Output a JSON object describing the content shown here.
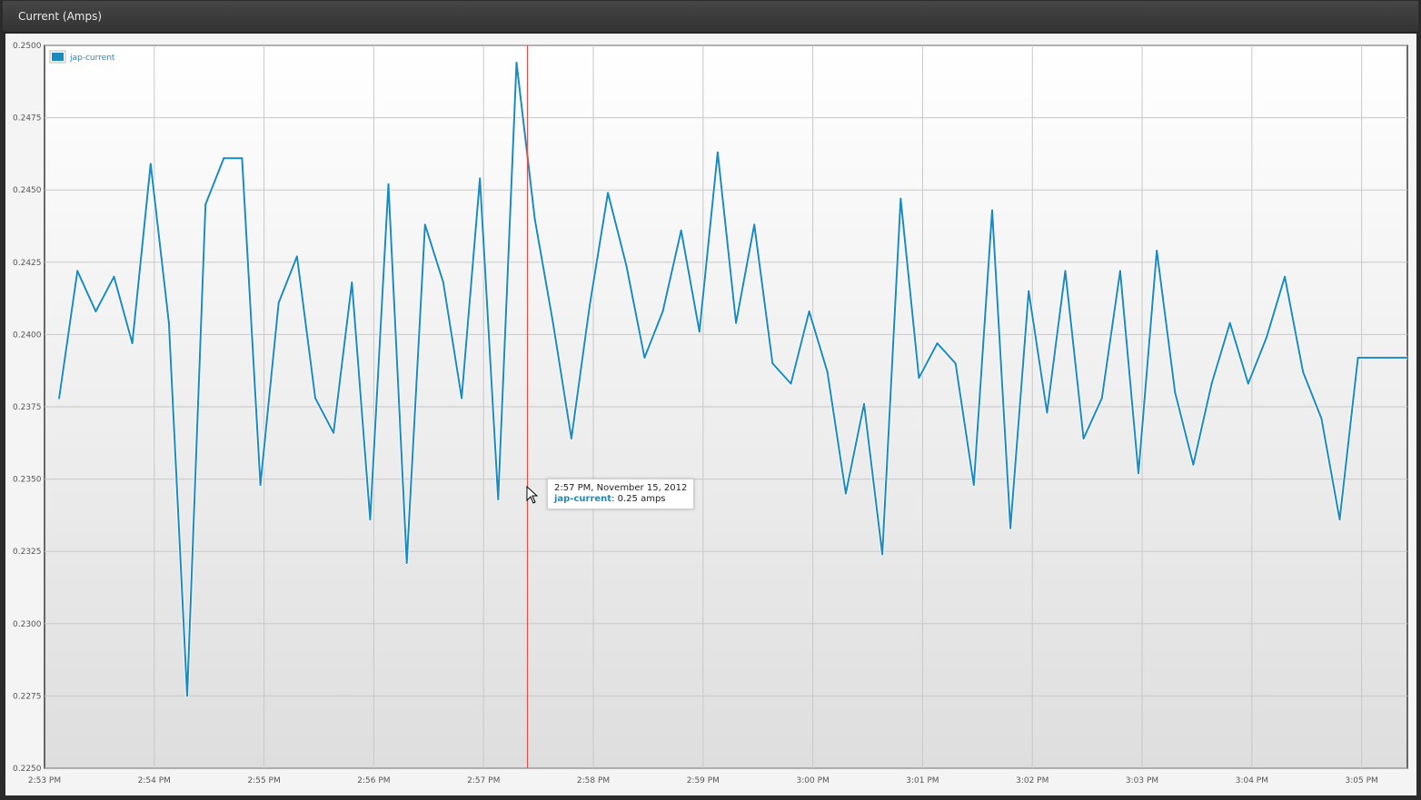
{
  "window": {
    "title": "Current (Amps)"
  },
  "tooltip": {
    "time": "2:57 PM, November 15, 2012",
    "series": "jap-current",
    "value_text": ": 0.25 amps"
  },
  "colors": {
    "line": "#1a8bc0",
    "crosshair": "#d9534f",
    "grid": "#c8c8c8"
  },
  "chart_data": {
    "type": "line",
    "title": "Current (Amps)",
    "xlabel": "",
    "ylabel": "",
    "legend": "top-left",
    "grid": true,
    "ylim": [
      0.225,
      0.25
    ],
    "xlim": [
      "2:53 PM",
      "3:05:25 PM"
    ],
    "x_ticks": [
      "2:53 PM",
      "2:54 PM",
      "2:55 PM",
      "2:56 PM",
      "2:57 PM",
      "2:58 PM",
      "2:59 PM",
      "3:00 PM",
      "3:01 PM",
      "3:02 PM",
      "3:03 PM",
      "3:04 PM",
      "3:05 PM"
    ],
    "y_ticks": [
      "0.2250",
      "0.2275",
      "0.2300",
      "0.2325",
      "0.2350",
      "0.2375",
      "0.2400",
      "0.2425",
      "0.2450",
      "0.2475",
      "0.2500"
    ],
    "crosshair_x": "2:57:24 PM",
    "series": [
      {
        "name": "jap-current",
        "x": [
          "2:53:08",
          "2:53:18",
          "2:53:28",
          "2:53:38",
          "2:53:48",
          "2:53:58",
          "2:54:08",
          "2:54:18",
          "2:54:28",
          "2:54:38",
          "2:54:48",
          "2:54:58",
          "2:55:08",
          "2:55:18",
          "2:55:28",
          "2:55:38",
          "2:55:48",
          "2:55:58",
          "2:56:08",
          "2:56:18",
          "2:56:28",
          "2:56:38",
          "2:56:48",
          "2:56:58",
          "2:57:08",
          "2:57:18",
          "2:57:28",
          "2:57:38",
          "2:57:48",
          "2:57:58",
          "2:58:08",
          "2:58:18",
          "2:58:28",
          "2:58:38",
          "2:58:48",
          "2:58:58",
          "2:59:08",
          "2:59:18",
          "2:59:28",
          "2:59:38",
          "2:59:48",
          "2:59:58",
          "3:00:08",
          "3:00:18",
          "3:00:28",
          "3:00:38",
          "3:00:48",
          "3:00:58",
          "3:01:08",
          "3:01:18",
          "3:01:28",
          "3:01:38",
          "3:01:48",
          "3:01:58",
          "3:02:08",
          "3:02:18",
          "3:02:28",
          "3:02:38",
          "3:02:48",
          "3:02:58",
          "3:03:08",
          "3:03:18",
          "3:03:28",
          "3:03:38",
          "3:03:48",
          "3:03:58",
          "3:04:08",
          "3:04:18",
          "3:04:28",
          "3:04:38",
          "3:04:48",
          "3:04:58",
          "3:05:08",
          "3:05:18"
        ],
        "values": [
          0.2378,
          0.2422,
          0.2408,
          0.242,
          0.2397,
          0.2459,
          0.2404,
          0.2275,
          0.2445,
          0.2461,
          0.2461,
          0.2348,
          0.2411,
          0.2427,
          0.2378,
          0.2366,
          0.2418,
          0.2336,
          0.2452,
          0.2321,
          0.2438,
          0.2418,
          0.2378,
          0.2454,
          0.2343,
          0.2494,
          0.244,
          0.2404,
          0.2364,
          0.241,
          0.2449,
          0.2424,
          0.2392,
          0.2408,
          0.2436,
          0.2401,
          0.2463,
          0.2404,
          0.2438,
          0.239,
          0.2383,
          0.2408,
          0.2387,
          0.2345,
          0.2376,
          0.2324,
          0.2447,
          0.2385,
          0.2397,
          0.239,
          0.2348,
          0.2443,
          0.2333,
          0.2415,
          0.2373,
          0.2422,
          0.2364,
          0.2378,
          0.2422,
          0.2352,
          0.2429,
          0.238,
          0.2355,
          0.2383,
          0.2404,
          0.2383,
          0.2399,
          0.242,
          0.2387,
          0.2371,
          0.2336,
          0.2392,
          0.2392,
          0.2392
        ]
      }
    ]
  }
}
